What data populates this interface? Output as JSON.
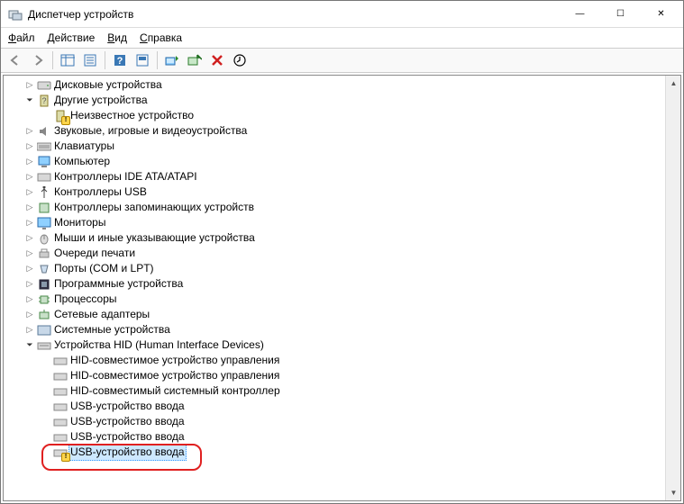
{
  "window": {
    "title": "Диспетчер устройств"
  },
  "menu": {
    "file": {
      "u": "Ф",
      "rest": "айл"
    },
    "action": {
      "u": "Д",
      "rest": "ействие"
    },
    "view": {
      "u": "В",
      "rest": "ид"
    },
    "help": {
      "u": "С",
      "rest": "правка"
    }
  },
  "tree": {
    "disk": "Дисковые устройства",
    "other": "Другие устройства",
    "unknown": "Неизвестное устройство",
    "sound": "Звуковые, игровые и видеоустройства",
    "keyboards": "Клавиатуры",
    "computer": "Компьютер",
    "ide": "Контроллеры IDE ATA/ATAPI",
    "usb": "Контроллеры USB",
    "storage": "Контроллеры запоминающих устройств",
    "monitors": "Мониторы",
    "mice": "Мыши и иные указывающие устройства",
    "printq": "Очереди печати",
    "ports": "Порты (COM и LPT)",
    "software": "Программные устройства",
    "cpu": "Процессоры",
    "netadapters": "Сетевые адаптеры",
    "sysdev": "Системные устройства",
    "hid": "Устройства HID (Human Interface Devices)",
    "hid_compat": "HID-совместимое устройство управления",
    "hid_sysctl": "HID-совместимый системный контроллер",
    "usb_input": "USB-устройство ввода"
  },
  "winctl": {
    "min": "—",
    "max": "☐",
    "close": "✕"
  }
}
